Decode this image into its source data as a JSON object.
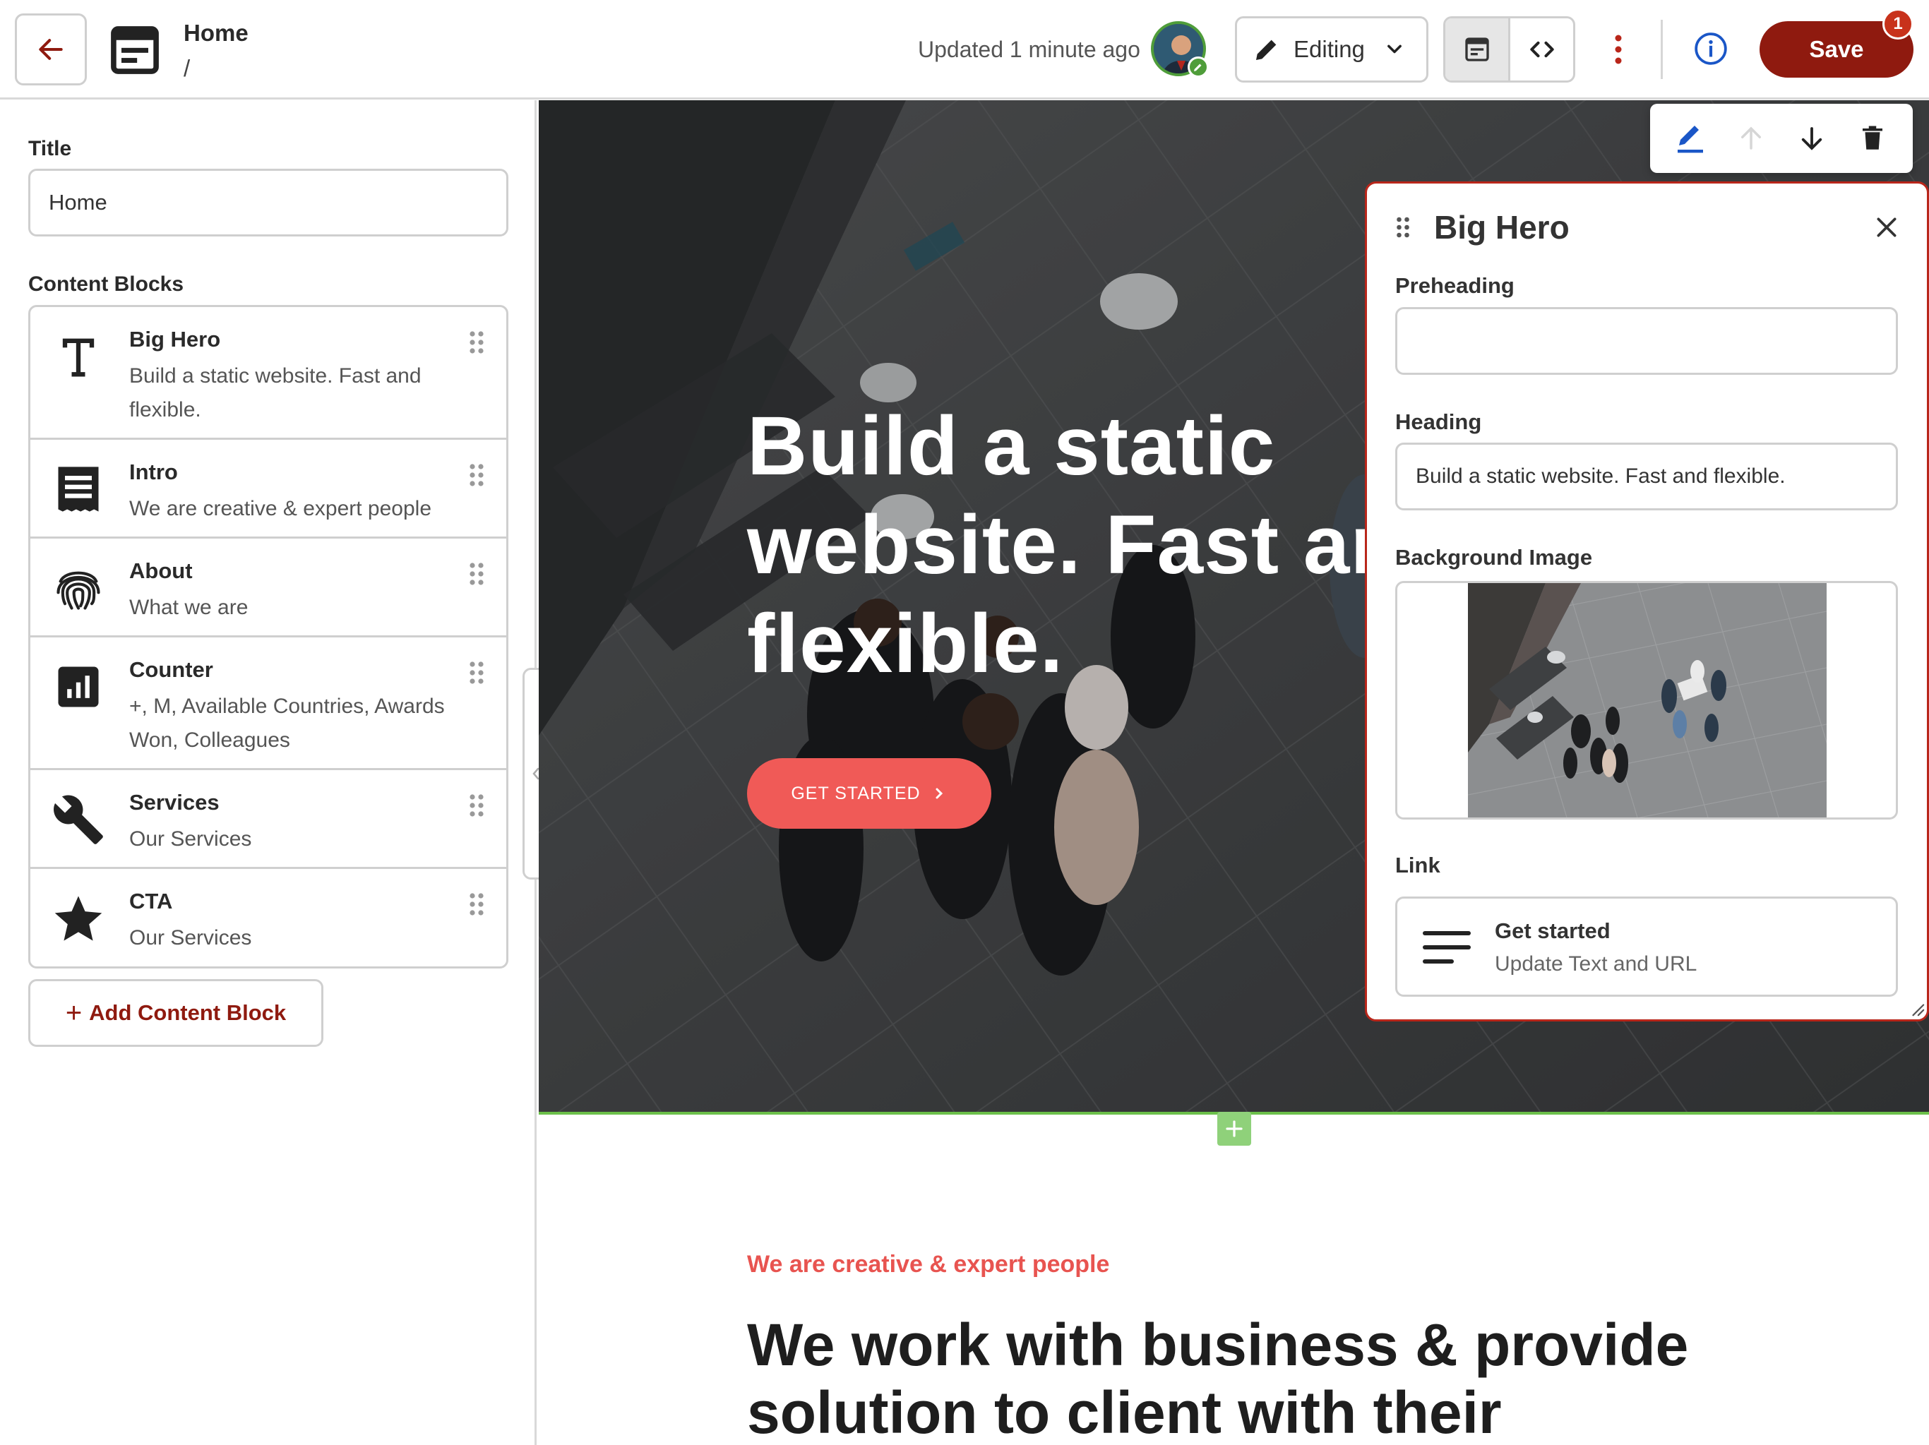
{
  "topbar": {
    "page_title": "Home",
    "breadcrumb_separator": "/",
    "updated_text": "Updated 1 minute ago",
    "mode_label": "Editing",
    "save_label": "Save",
    "save_badge_count": "1"
  },
  "sidebar": {
    "title_heading": "Title",
    "title_value": "Home",
    "blocks_heading": "Content Blocks",
    "blocks": [
      {
        "name": "Big Hero",
        "description": "Build a static website. Fast and flexible.",
        "icon": "text-t-icon"
      },
      {
        "name": "Intro",
        "description": "We are creative & expert people",
        "icon": "article-icon"
      },
      {
        "name": "About",
        "description": "What we are",
        "icon": "fingerprint-icon"
      },
      {
        "name": "Counter",
        "description": "+, M, Available Countries, Awards Won, Colleagues",
        "icon": "bar-chart-icon"
      },
      {
        "name": "Services",
        "description": "Our Services",
        "icon": "wrench-icon"
      },
      {
        "name": "CTA",
        "description": "Our Services",
        "icon": "star-icon"
      }
    ],
    "add_block_label": "Add Content Block"
  },
  "preview": {
    "hero_heading": "Build a static website. Fast and flexible.",
    "hero_cta": "GET STARTED",
    "intro_preheading": "We are creative & expert people",
    "intro_heading": "We work with business & provide solution to client with their"
  },
  "panel": {
    "title": "Big Hero",
    "preheading_label": "Preheading",
    "preheading_value": "",
    "heading_label": "Heading",
    "heading_value": "Build a static website. Fast and flexible.",
    "background_label": "Background Image",
    "link_label": "Link",
    "link_title": "Get started",
    "link_subtitle": "Update Text and URL"
  },
  "colors": {
    "save_button": "#8f1a0f",
    "hero_cta": "#f05a57",
    "accent_text": "#e85450",
    "panel_border": "#b9261a",
    "edit_icon": "#1a56c7"
  }
}
